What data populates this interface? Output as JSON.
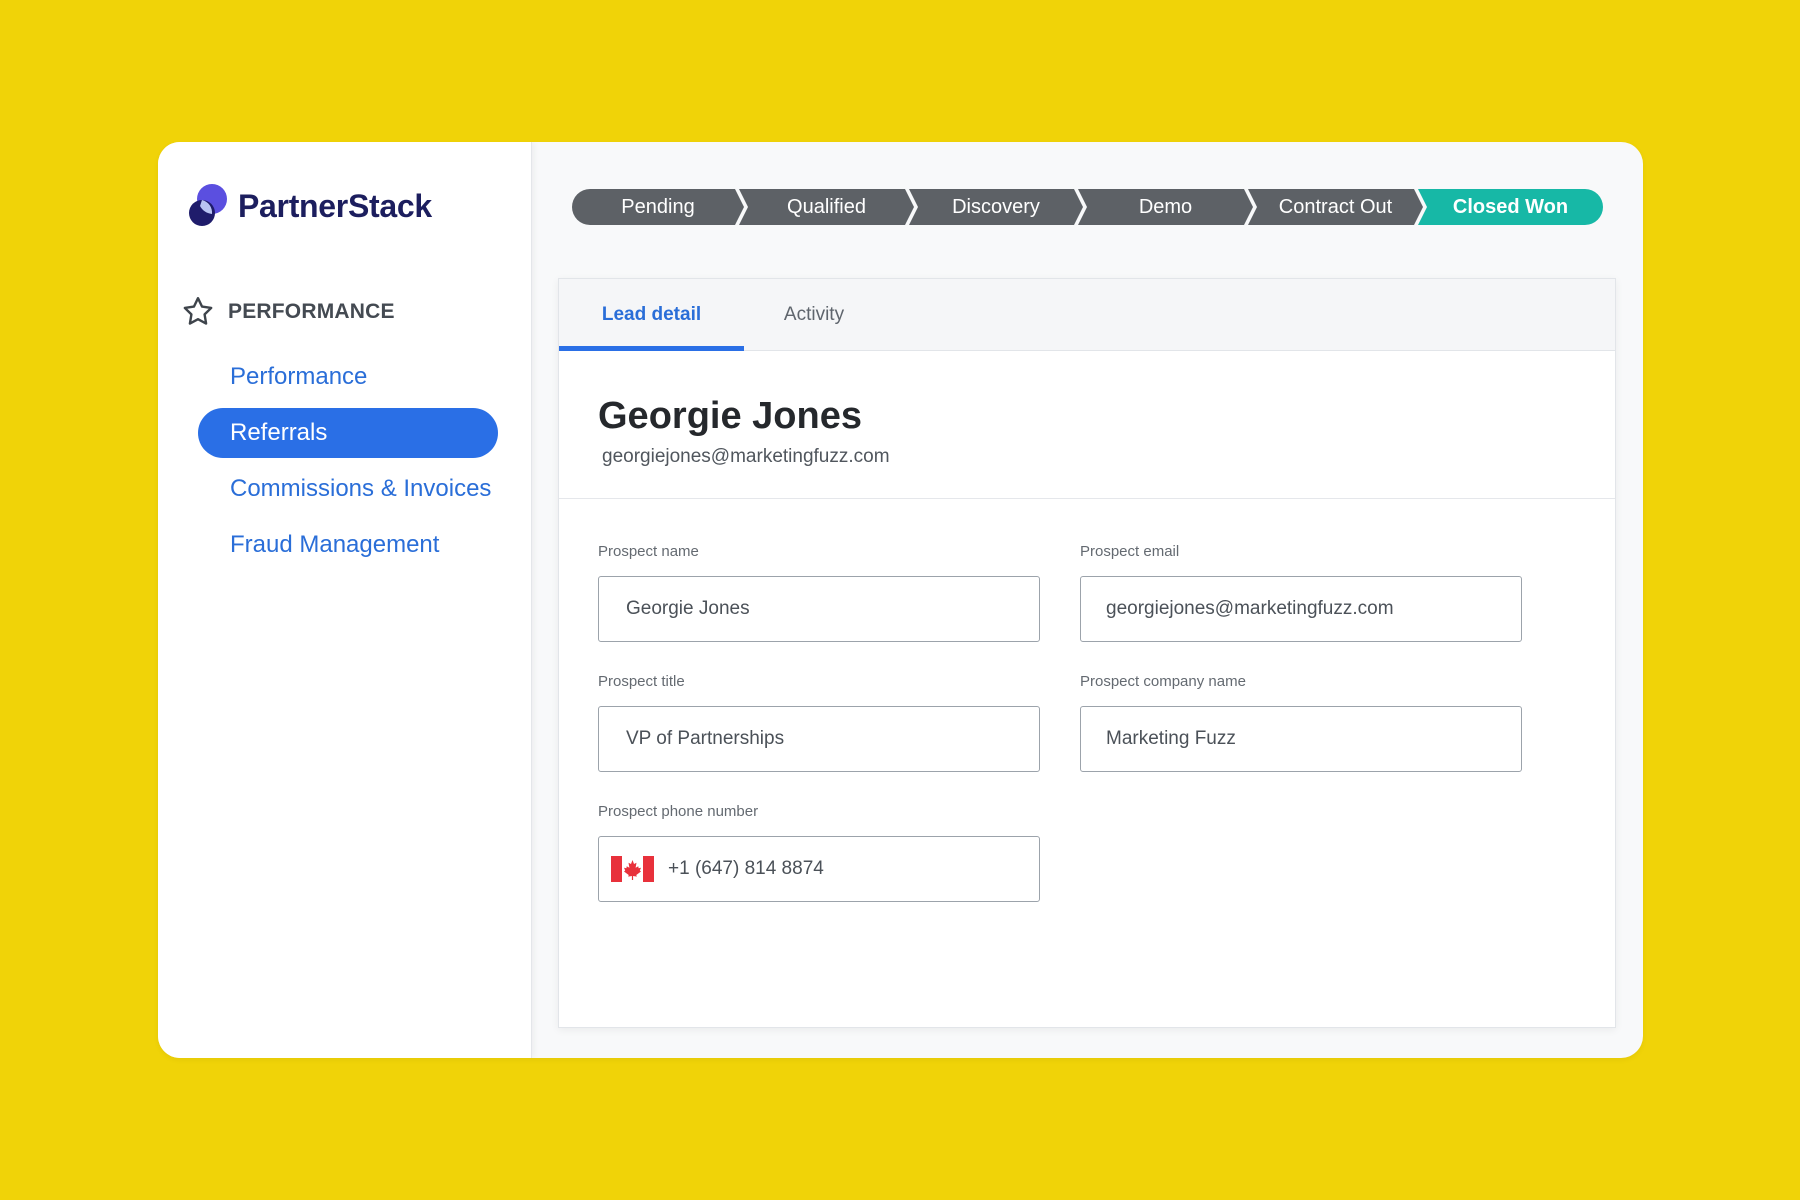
{
  "brand": {
    "name": "PartnerStack"
  },
  "sidebar": {
    "section_title": "PERFORMANCE",
    "items": [
      {
        "label": "Performance",
        "active": false
      },
      {
        "label": "Referrals",
        "active": true
      },
      {
        "label": "Commissions & Invoices",
        "active": false
      },
      {
        "label": "Fraud Management",
        "active": false
      }
    ]
  },
  "pipeline": {
    "stages": [
      "Pending",
      "Qualified",
      "Discovery",
      "Demo",
      "Contract Out",
      "Closed Won"
    ],
    "current": "Closed Won",
    "colors": {
      "stage": "#5d6166",
      "current": "#17b8a6"
    }
  },
  "tabs": [
    {
      "label": "Lead detail",
      "active": true
    },
    {
      "label": "Activity",
      "active": false
    }
  ],
  "lead": {
    "name": "Georgie Jones",
    "email": "georgiejones@marketingfuzz.com"
  },
  "form": {
    "prospect_name": {
      "label": "Prospect name",
      "value": "Georgie Jones"
    },
    "prospect_email": {
      "label": "Prospect email",
      "value": "georgiejones@marketingfuzz.com"
    },
    "prospect_title": {
      "label": "Prospect title",
      "value": "VP of Partnerships"
    },
    "prospect_company": {
      "label": "Prospect company name",
      "value": "Marketing Fuzz"
    },
    "prospect_phone": {
      "label": "Prospect phone number",
      "value": "+1 (647) 814 8874",
      "country_icon": "canada-flag-icon"
    }
  },
  "colors": {
    "background": "#f0d308",
    "accent": "#2a6fe6",
    "link": "#2a6ed8",
    "brand_text": "#1c1e5e"
  }
}
